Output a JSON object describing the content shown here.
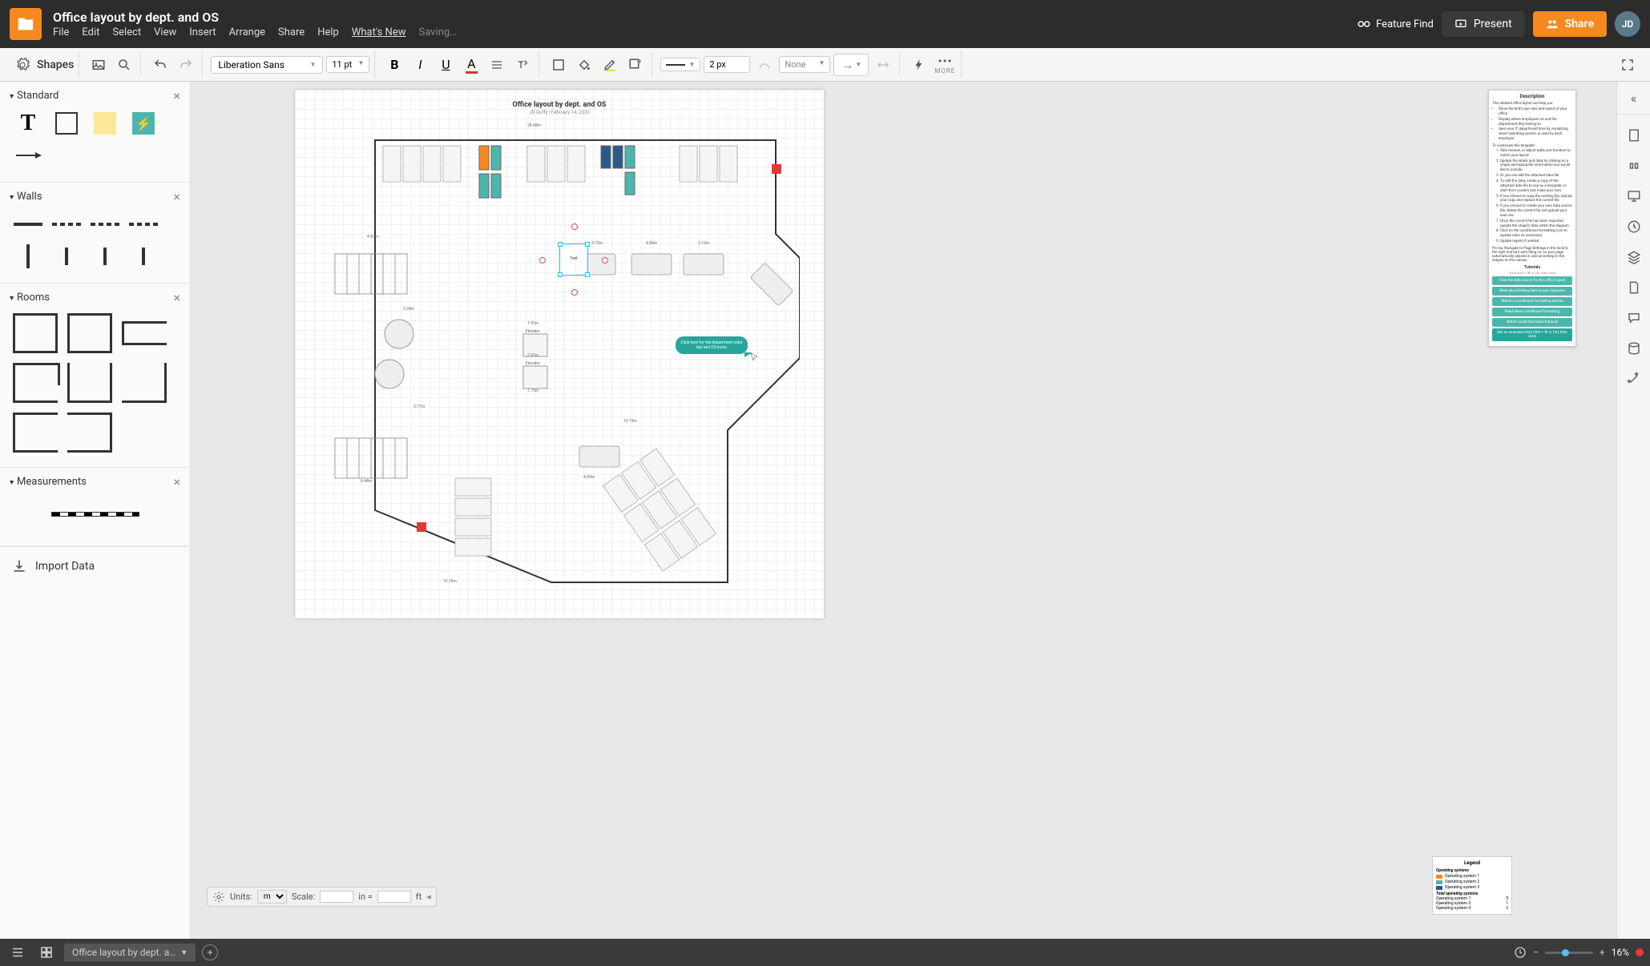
{
  "header": {
    "doc_title": "Office layout by dept. and OS",
    "menu": [
      "File",
      "Edit",
      "Select",
      "View",
      "Insert",
      "Arrange",
      "Share",
      "Help",
      "What's New"
    ],
    "saving_text": "Saving…",
    "feature_find": "Feature Find",
    "present": "Present",
    "share": "Share",
    "avatar": "JD"
  },
  "toolbar": {
    "shapes_label": "Shapes",
    "font_family": "Liberation Sans",
    "font_size": "11 pt",
    "line_width": "2 px",
    "endpoint": "None",
    "more_label": "MORE"
  },
  "shapes_panel": {
    "sections": {
      "standard": "Standard",
      "walls": "Walls",
      "rooms": "Rooms",
      "measurements": "Measurements"
    },
    "import_data": "Import Data"
  },
  "canvas": {
    "title": "Office layout by dept. and OS",
    "subtitle": "JD Duffy | February 14, 2020",
    "selected_label": "Text",
    "callout_text": "Click here for the department color key and OS icons",
    "dim_top": "28.49m",
    "dim_left1": "4.52m",
    "dim_mid": "16.19m",
    "dim1": "3.75m",
    "dim2": "4.84m",
    "dim3": "3.15m",
    "dim4": "2.92m",
    "dim5": "1.75m",
    "dim6": "5.28m",
    "dim7": "6.47m",
    "dim8": "3.77m",
    "dim9": "4.69m",
    "elevator": "Elevator"
  },
  "description": {
    "heading": "Description",
    "intro": "This detailed office layout can help you:",
    "bullets": [
      "Show the bird's-eye view and layout of your office.",
      "Display where employees sit and the department they belong to.",
      "Save your IT department time by visualizing which operating system is used by each employee."
    ],
    "customize_heading": "To customize this template:",
    "steps": [
      "Add, remove, or adjust walls and furniture to match your layout.",
      "Update the labels and data by clicking on a shape and typing the information you would like to include.",
      "Or you can edit the attached data file.",
      "To edit the data, create a copy of the attached data file to use as a template, or start from scratch and make your own.",
      "If you choose to copy the existing file, upload your copy and replace the current file.",
      "If you choose to create your own data source file, delete the current file and upload your new one.",
      "Once the correct file has been imported, update the shape's data within the diagram.",
      "Click on the conditional formatting icon to update rules as necessary.",
      "Update legend if needed."
    ],
    "pro_tip": "Pro tip: Navigate to Page Settings in the dock to the right and turn auto tiling on, so your page automatically adjusts in size according to the shapes on the canvas."
  },
  "tutorials": {
    "heading": "Tutorials",
    "subtitle": "(Hold Shift + ⌘ or Ctrl, then click)",
    "items": [
      "View the data source for this office layout",
      "Read about linking data to your diagrams",
      "Watch a conditional formatting tutorial",
      "Read about conditional formatting",
      "Watch Lucidchart basic tutorials",
      "See an example (Hold Shift + ⌘ or Ctrl, then click)"
    ]
  },
  "legend": {
    "heading": "Legend",
    "os_heading": "Operating systems",
    "os_items": [
      {
        "label": "Operating system 1",
        "color": "#f68a1e"
      },
      {
        "label": "Operating system 2",
        "color": "#4db6ac"
      },
      {
        "label": "Operating system 3",
        "color": "#2b5a8a"
      }
    ],
    "total_heading": "Total operating systems",
    "totals": [
      {
        "label": "Operating system 1:",
        "value": "5"
      },
      {
        "label": "Operating system 2:",
        "value": "1"
      },
      {
        "label": "Operating system 3:",
        "value": "2"
      }
    ]
  },
  "units_bar": {
    "units_label": "Units:",
    "units_value": "m",
    "scale_label": "Scale:",
    "eq": "in =",
    "unit_right": "ft"
  },
  "bottom": {
    "page_name": "Office layout by dept. a…",
    "zoom": "16%"
  }
}
